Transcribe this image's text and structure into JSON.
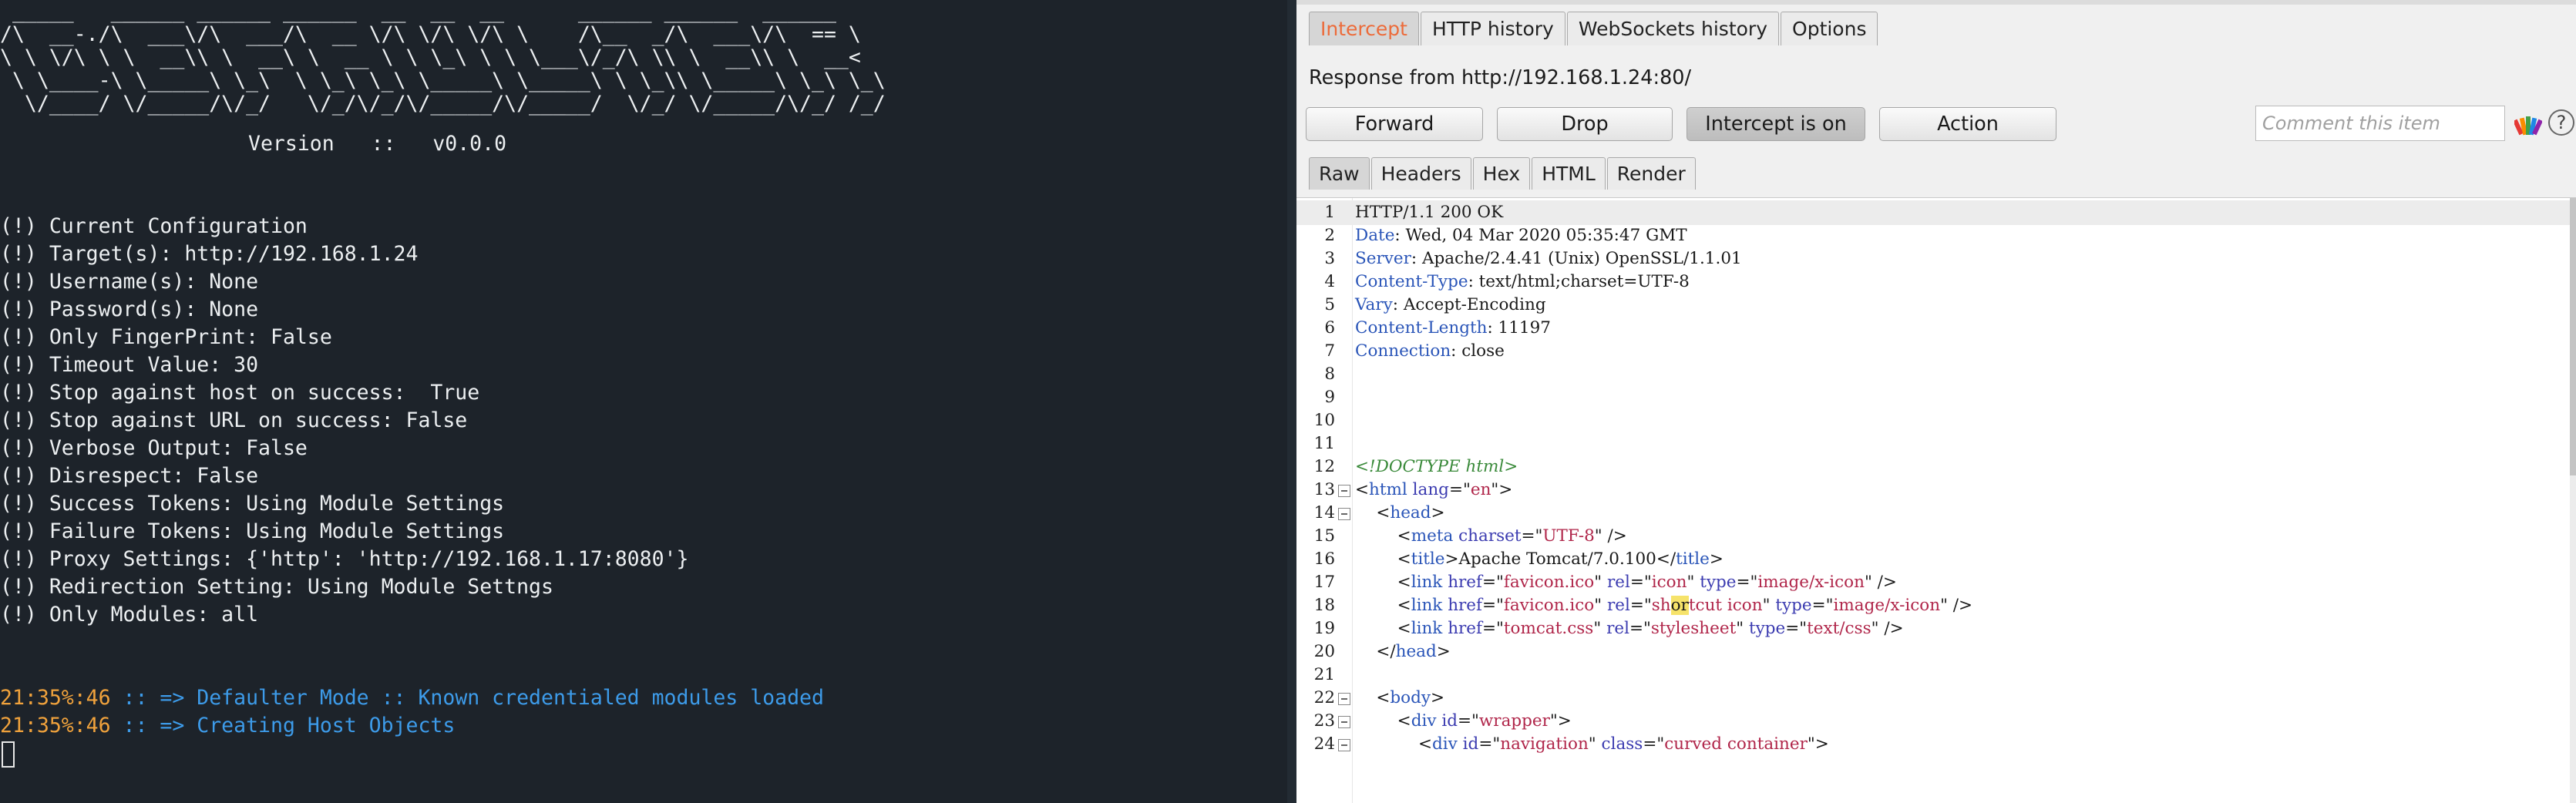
{
  "terminal": {
    "banner_art": " _____   ______ ______ ______  __  __  __      ______ ______  ______\n/\\  __-./\\  ___\\/\\  ___/\\  __ \\/\\ \\/\\ \\/\\ \\    /\\__  _/\\  ___\\/\\  == \\\n\\ \\ \\/\\ \\ \\  __\\\\ \\  __\\ \\  __ \\ \\ \\_\\ \\ \\ \\___\\/_/\\ \\\\ \\  __\\\\ \\  __<\n \\ \\____-\\ \\_____\\ \\_\\  \\ \\_\\ \\_\\ \\_____\\ \\_____\\ \\ \\_\\\\ \\_____\\ \\_\\ \\_\\\n  \\/____/ \\/_____/\\/_/   \\/_/\\/_/\\/_____/\\/_____/  \\/_/ \\/_____/\\/_/ /_/",
    "banner_version": "Version   ::   v0.0.0",
    "config_lines": [
      "(!) Current Configuration",
      "(!) Target(s): http://192.168.1.24",
      "(!) Username(s): None",
      "(!) Password(s): None",
      "(!) Only FingerPrint: False",
      "(!) Timeout Value: 30",
      "(!) Stop against host on success:  True",
      "(!) Stop against URL on success: False",
      "(!) Verbose Output: False",
      "(!) Disrespect: False",
      "(!) Success Tokens: Using Module Settings",
      "(!) Failure Tokens: Using Module Settings",
      "(!) Proxy Settings: {'http': 'http://192.168.1.17:8080'}",
      "(!) Redirection Setting: Using Module Settngs",
      "(!) Only Modules: all"
    ],
    "log_lines": [
      {
        "time": "21:35%:46",
        "msg": " :: => Defaulter Mode :: Known credentialed modules loaded"
      },
      {
        "time": "21:35%:46",
        "msg": " :: => Creating Host Objects"
      }
    ],
    "colors": {
      "background": "#1d232a",
      "text": "#eceff1",
      "time": "#f0a23c",
      "message": "#3d9be9"
    }
  },
  "burp": {
    "intercept_tabs": [
      {
        "label": "Intercept",
        "active": true
      },
      {
        "label": "HTTP history",
        "active": false
      },
      {
        "label": "WebSockets history",
        "active": false
      },
      {
        "label": "Options",
        "active": false
      }
    ],
    "response_label": "Response from http://192.168.1.24:80/",
    "toolbar": {
      "forward": "Forward",
      "drop": "Drop",
      "intercept": "Intercept is on",
      "action": "Action",
      "comment_placeholder": "Comment this item",
      "highlight_icon": "highlighter-icon",
      "help_icon": "help-icon",
      "help_glyph": "?"
    },
    "view_tabs": [
      {
        "label": "Raw",
        "active": true
      },
      {
        "label": "Headers",
        "active": false
      },
      {
        "label": "Hex",
        "active": false
      },
      {
        "label": "HTML",
        "active": false
      },
      {
        "label": "Render",
        "active": false
      }
    ],
    "accent_color": "#ec6b3a",
    "code_lines": [
      {
        "n": "1",
        "fold": false,
        "parts": [
          [
            "t",
            "HTTP/1.1 200 OK"
          ]
        ]
      },
      {
        "n": "2",
        "fold": false,
        "parts": [
          [
            "hk",
            "Date"
          ],
          [
            "t",
            ": Wed, 04 Mar 2020 05:35:47 GMT"
          ]
        ]
      },
      {
        "n": "3",
        "fold": false,
        "parts": [
          [
            "hk",
            "Server"
          ],
          [
            "t",
            ": Apache/2.4.41 (Unix) OpenSSL/1.1.01"
          ]
        ]
      },
      {
        "n": "4",
        "fold": false,
        "parts": [
          [
            "hk",
            "Content-Type"
          ],
          [
            "t",
            ": text/html;charset=UTF-8"
          ]
        ]
      },
      {
        "n": "5",
        "fold": false,
        "parts": [
          [
            "hk",
            "Vary"
          ],
          [
            "t",
            ": Accept-Encoding"
          ]
        ]
      },
      {
        "n": "6",
        "fold": false,
        "parts": [
          [
            "hk",
            "Content-Length"
          ],
          [
            "t",
            ": 11197"
          ]
        ]
      },
      {
        "n": "7",
        "fold": false,
        "parts": [
          [
            "hk",
            "Connection"
          ],
          [
            "t",
            ": close"
          ]
        ]
      },
      {
        "n": "8",
        "fold": false,
        "parts": []
      },
      {
        "n": "9",
        "fold": false,
        "parts": []
      },
      {
        "n": "10",
        "fold": false,
        "parts": []
      },
      {
        "n": "11",
        "fold": false,
        "parts": []
      },
      {
        "n": "12",
        "fold": false,
        "parts": [
          [
            "dt",
            "<!DOCTYPE html>"
          ]
        ]
      },
      {
        "n": "13",
        "fold": true,
        "parts": [
          [
            "t",
            "<"
          ],
          [
            "tg",
            "html"
          ],
          [
            "t",
            " "
          ],
          [
            "at",
            "lang"
          ],
          [
            "t",
            "=\""
          ],
          [
            "av",
            "en"
          ],
          [
            "t",
            "\">"
          ]
        ]
      },
      {
        "n": "14",
        "fold": true,
        "parts": [
          [
            "t",
            "    <"
          ],
          [
            "tg",
            "head"
          ],
          [
            "t",
            ">"
          ]
        ]
      },
      {
        "n": "15",
        "fold": false,
        "parts": [
          [
            "t",
            "        <"
          ],
          [
            "tg",
            "meta"
          ],
          [
            "t",
            " "
          ],
          [
            "at",
            "charset"
          ],
          [
            "t",
            "=\""
          ],
          [
            "av",
            "UTF-8"
          ],
          [
            "t",
            "\" />"
          ]
        ]
      },
      {
        "n": "16",
        "fold": false,
        "parts": [
          [
            "t",
            "        <"
          ],
          [
            "tg",
            "title"
          ],
          [
            "t",
            ">Apache Tomcat/7.0.100</"
          ],
          [
            "tg",
            "title"
          ],
          [
            "t",
            ">"
          ]
        ]
      },
      {
        "n": "17",
        "fold": false,
        "parts": [
          [
            "t",
            "        <"
          ],
          [
            "tg",
            "link"
          ],
          [
            "t",
            " "
          ],
          [
            "at",
            "href"
          ],
          [
            "t",
            "=\""
          ],
          [
            "av",
            "favicon.ico"
          ],
          [
            "t",
            "\" "
          ],
          [
            "at",
            "rel"
          ],
          [
            "t",
            "=\""
          ],
          [
            "av",
            "icon"
          ],
          [
            "t",
            "\" "
          ],
          [
            "at",
            "type"
          ],
          [
            "t",
            "=\""
          ],
          [
            "av",
            "image/x-icon"
          ],
          [
            "t",
            "\" />"
          ]
        ]
      },
      {
        "n": "18",
        "fold": false,
        "parts": [
          [
            "t",
            "        <"
          ],
          [
            "tg",
            "link"
          ],
          [
            "t",
            " "
          ],
          [
            "at",
            "href"
          ],
          [
            "t",
            "=\""
          ],
          [
            "av",
            "favicon.ico"
          ],
          [
            "t",
            "\" "
          ],
          [
            "at",
            "rel"
          ],
          [
            "t",
            "=\""
          ],
          [
            "av",
            "sh"
          ],
          [
            "hl",
            "or"
          ],
          [
            "av",
            "tcut icon"
          ],
          [
            "t",
            "\" "
          ],
          [
            "at",
            "type"
          ],
          [
            "t",
            "=\""
          ],
          [
            "av",
            "image/x-icon"
          ],
          [
            "t",
            "\" />"
          ]
        ]
      },
      {
        "n": "19",
        "fold": false,
        "parts": [
          [
            "t",
            "        <"
          ],
          [
            "tg",
            "link"
          ],
          [
            "t",
            " "
          ],
          [
            "at",
            "href"
          ],
          [
            "t",
            "=\""
          ],
          [
            "av",
            "tomcat.css"
          ],
          [
            "t",
            "\" "
          ],
          [
            "at",
            "rel"
          ],
          [
            "t",
            "=\""
          ],
          [
            "av",
            "stylesheet"
          ],
          [
            "t",
            "\" "
          ],
          [
            "at",
            "type"
          ],
          [
            "t",
            "=\""
          ],
          [
            "av",
            "text/css"
          ],
          [
            "t",
            "\" />"
          ]
        ]
      },
      {
        "n": "20",
        "fold": false,
        "parts": [
          [
            "t",
            "    </"
          ],
          [
            "tg",
            "head"
          ],
          [
            "t",
            ">"
          ]
        ]
      },
      {
        "n": "21",
        "fold": false,
        "parts": []
      },
      {
        "n": "22",
        "fold": true,
        "parts": [
          [
            "t",
            "    <"
          ],
          [
            "tg",
            "body"
          ],
          [
            "t",
            ">"
          ]
        ]
      },
      {
        "n": "23",
        "fold": true,
        "parts": [
          [
            "t",
            "        <"
          ],
          [
            "tg",
            "div"
          ],
          [
            "t",
            " "
          ],
          [
            "at",
            "id"
          ],
          [
            "t",
            "=\""
          ],
          [
            "av",
            "wrapper"
          ],
          [
            "t",
            "\">"
          ]
        ]
      },
      {
        "n": "24",
        "fold": true,
        "parts": [
          [
            "t",
            "            <"
          ],
          [
            "tg",
            "div"
          ],
          [
            "t",
            " "
          ],
          [
            "at",
            "id"
          ],
          [
            "t",
            "=\""
          ],
          [
            "av",
            "navigation"
          ],
          [
            "t",
            "\" "
          ],
          [
            "at",
            "class"
          ],
          [
            "t",
            "=\""
          ],
          [
            "av",
            "curved container"
          ],
          [
            "t",
            "\">"
          ]
        ]
      }
    ]
  }
}
